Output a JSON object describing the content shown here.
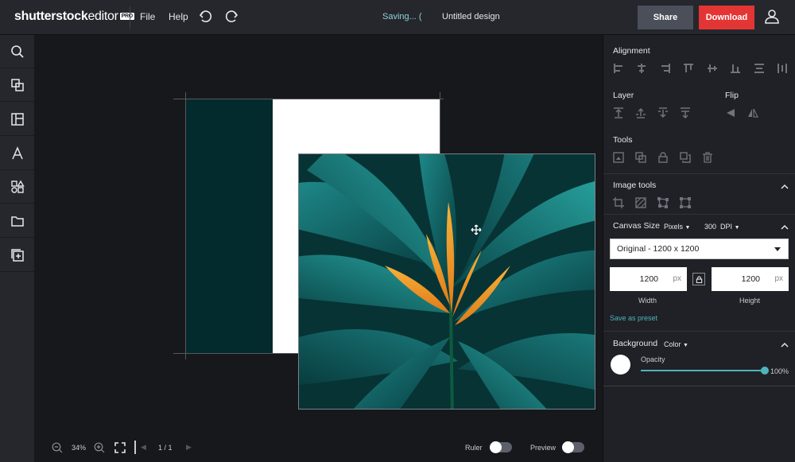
{
  "app": {
    "logo_main": "shutterstock",
    "logo_sub": "editor",
    "logo_badge": "PRO",
    "menu": [
      "File",
      "Help"
    ],
    "status": "Saving... (",
    "document_title": "Untitled design",
    "share_label": "Share",
    "download_label": "Download"
  },
  "left_tools": [
    {
      "name": "search-icon"
    },
    {
      "name": "elements-icon"
    },
    {
      "name": "templates-icon"
    },
    {
      "name": "text-icon"
    },
    {
      "name": "shapes-icon"
    },
    {
      "name": "folder-icon"
    },
    {
      "name": "add-layer-icon"
    }
  ],
  "canvas": {
    "artboard_color": "#ffffff",
    "teal_rect_color": "#032a2c",
    "photo_description_color": "#0b4a4c"
  },
  "bottom": {
    "zoom": "34%",
    "page": "1 / 1",
    "ruler_label": "Ruler",
    "preview_label": "Preview"
  },
  "panel": {
    "alignment_title": "Alignment",
    "layer_title": "Layer",
    "flip_title": "Flip",
    "tools_title": "Tools",
    "image_tools_title": "Image tools",
    "canvas_size_title": "Canvas Size",
    "units": "Pixels",
    "dpi_value": "300",
    "dpi_label": "DPI",
    "preset_value": "Original - 1200 x 1200",
    "width_value": "1200",
    "height_value": "1200",
    "unit_suffix": "px",
    "width_label": "Width",
    "height_label": "Height",
    "save_preset": "Save as preset",
    "background_title": "Background",
    "background_mode": "Color",
    "opacity_label": "Opacity",
    "opacity_value": "100%",
    "background_color": "#ffffff",
    "accent_color": "#4fb3bd"
  }
}
